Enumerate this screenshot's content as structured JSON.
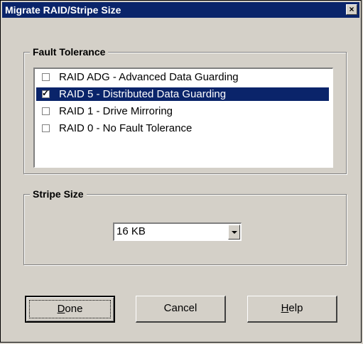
{
  "window": {
    "title": "Migrate RAID/Stripe Size",
    "close_glyph": "×"
  },
  "fault_tolerance": {
    "title": "Fault Tolerance",
    "items": [
      {
        "label": "RAID ADG - Advanced Data Guarding",
        "checked": false,
        "selected": false
      },
      {
        "label": "RAID 5 - Distributed Data Guarding",
        "checked": true,
        "selected": true
      },
      {
        "label": "RAID 1 - Drive Mirroring",
        "checked": false,
        "selected": false
      },
      {
        "label": "RAID 0 - No Fault Tolerance",
        "checked": false,
        "selected": false
      }
    ],
    "check_glyph": "✓"
  },
  "stripe_size": {
    "title": "Stripe Size",
    "value": "16 KB"
  },
  "buttons": {
    "done": {
      "mnemonic": "D",
      "rest": "one"
    },
    "cancel": {
      "label": "Cancel"
    },
    "help": {
      "mnemonic": "H",
      "rest": "elp"
    }
  }
}
